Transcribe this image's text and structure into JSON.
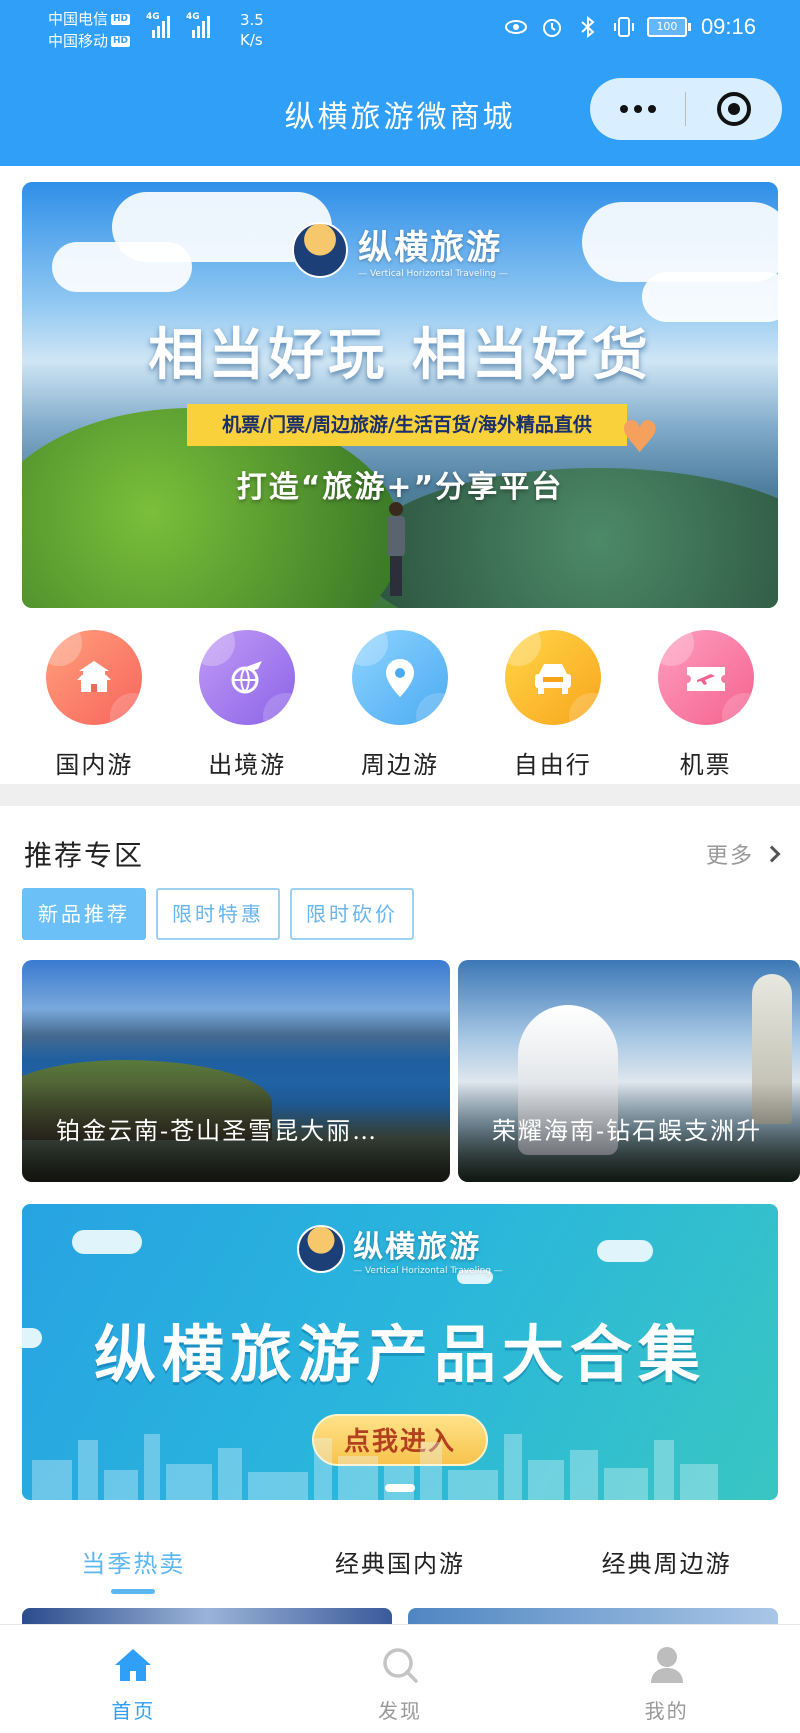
{
  "status_bar": {
    "carrier1": "中国电信",
    "carrier2": "中国移动",
    "hd_badge": "HD",
    "net_type": "4G",
    "net_speed_value": "3.5",
    "net_speed_unit": "K/s",
    "battery": "100",
    "time": "09:16"
  },
  "header": {
    "title": "纵横旅游微商城"
  },
  "banner": {
    "brand": "纵横旅游",
    "brand_sub": "— Vertical Horizontal Traveling —",
    "headline": "相当好玩 相当好货",
    "strip": "机票/门票/周边旅游/生活百货/海外精品直供",
    "slogan": "打造“旅游+”分享平台"
  },
  "categories": [
    {
      "label": "国内游",
      "icon": "temple-icon",
      "color_from": "#ffa07a",
      "color_to": "#f8645e"
    },
    {
      "label": "出境游",
      "icon": "globe-plane-icon",
      "color_from": "#c29bf5",
      "color_to": "#8a63e8"
    },
    {
      "label": "周边游",
      "icon": "location-pin-icon",
      "color_from": "#8fd4ff",
      "color_to": "#4aaaf2"
    },
    {
      "label": "自由行",
      "icon": "car-icon",
      "color_from": "#ffd64a",
      "color_to": "#f9a51b"
    },
    {
      "label": "机票",
      "icon": "plane-ticket-icon",
      "color_from": "#ff9ec0",
      "color_to": "#f4628f"
    }
  ],
  "recommend": {
    "title": "推荐专区",
    "more": "更多",
    "tabs": [
      {
        "label": "新品推荐",
        "active": true
      },
      {
        "label": "限时特惠",
        "active": false
      },
      {
        "label": "限时砍价",
        "active": false
      }
    ],
    "cards": [
      {
        "title": "铂金云南-苍山圣雪昆大丽…"
      },
      {
        "title": "荣耀海南-钻石蜈支洲升"
      }
    ]
  },
  "promo": {
    "brand": "纵横旅游",
    "brand_sub": "— Vertical Horizontal Traveling —",
    "title": "纵横旅游产品大合集",
    "button": "点我进入"
  },
  "hot_tabs": [
    {
      "label": "当季热卖",
      "active": true
    },
    {
      "label": "经典国内游",
      "active": false
    },
    {
      "label": "经典周边游",
      "active": false
    }
  ],
  "bottom_nav": [
    {
      "label": "首页",
      "icon": "home-icon",
      "active": true
    },
    {
      "label": "发现",
      "icon": "search-icon",
      "active": false
    },
    {
      "label": "我的",
      "icon": "user-icon",
      "active": false
    }
  ],
  "colors": {
    "header_bg": "#2f9ff8",
    "accent": "#5cb6f0",
    "banner_strip": "#f8d13b",
    "promo_button": "#f8c34c"
  }
}
